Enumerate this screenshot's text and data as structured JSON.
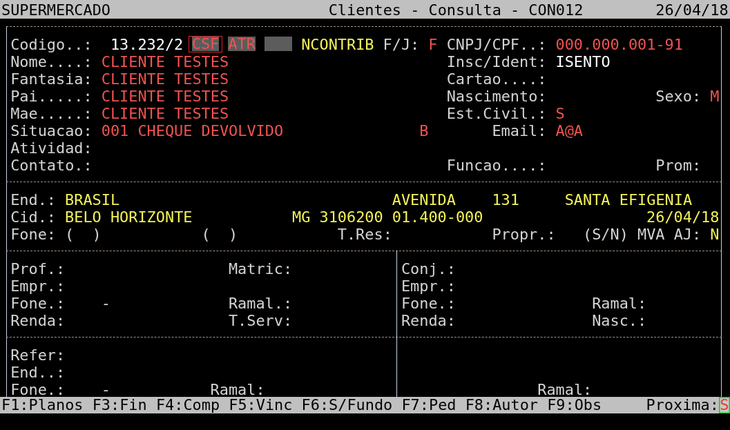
{
  "title_bar": {
    "system": "SUPERMERCADO",
    "title": "Clientes - Consulta - CON012",
    "date": "26/04/18"
  },
  "client": {
    "fields": [
      {
        "label": "Codigo..:",
        "value": "13.232/2",
        "color": "#ffffff",
        "flags": [
          {
            "kind": "tag",
            "text": "CSF",
            "selected": true
          },
          {
            "kind": "tag",
            "text": "ATR",
            "selected": false
          },
          {
            "kind": "blank",
            "selected": false
          }
        ]
      },
      {
        "value": "NCONTRIB",
        "color": "#f2f25a"
      },
      {
        "label": "F/J:",
        "value": "F",
        "color": "#ef5350"
      },
      {
        "label": "CNPJ/CPF..:",
        "value": "000.000.001-91",
        "color": "#ef5350"
      },
      {
        "label": "Nome....:",
        "value": "CLIENTE TESTES",
        "color": "#ef5350"
      },
      {
        "label": "Insc/Ident:",
        "value": "ISENTO",
        "color": "#ffffff"
      },
      {
        "label": "Fantasia:",
        "value": "CLIENTE TESTES",
        "color": "#ef5350"
      },
      {
        "label": "Cartao....:"
      },
      {
        "label": "Pai.....:",
        "value": "CLIENTE TESTES",
        "color": "#ef5350"
      },
      {
        "label": "Nascimento:"
      },
      {
        "label": "Sexo:",
        "value": "M",
        "color": "#ef5350"
      },
      {
        "label": "Mae.....:",
        "value": "CLIENTE TESTES",
        "color": "#ef5350"
      },
      {
        "label": "Est.Civil.:",
        "value": "S",
        "color": "#ef5350"
      },
      {
        "label": "Situacao:",
        "value": "001 CHEQUE DEVOLVIDO",
        "color": "#ef5350"
      },
      {
        "value": "B",
        "color": "#ef5350"
      },
      {
        "label": "Email:",
        "value": "A@A",
        "color": "#ef5350"
      },
      {
        "label": "Atividad:"
      },
      {
        "label": "Contato.:"
      },
      {
        "label": "Funcao....:"
      },
      {
        "label": "Prom:"
      }
    ]
  },
  "address": {
    "fields": [
      {
        "label": "End.:",
        "value": "BRASIL",
        "color": "#f2f25a"
      },
      {
        "value": "AVENIDA",
        "color": "#f2f25a"
      },
      {
        "value": "131",
        "color": "#f2f25a"
      },
      {
        "value": "SANTA EFIGENIA",
        "color": "#f2f25a"
      },
      {
        "label": "Cid.:",
        "value": "BELO HORIZONTE",
        "color": "#f2f25a"
      },
      {
        "value": "MG",
        "color": "#f2f25a"
      },
      {
        "value": "3106200",
        "color": "#f2f25a"
      },
      {
        "value": "01.400-000",
        "color": "#f2f25a"
      },
      {
        "value": "26/04/18",
        "color": "#f2f25a"
      },
      {
        "label": "Fone:",
        "value": "(  )",
        "color": "#d3d3d3"
      },
      {
        "value": "(  )",
        "color": "#d3d3d3"
      },
      {
        "label": "T.Res:"
      },
      {
        "label": "Propr.:"
      },
      {
        "label": "(S/N) MVA AJ:",
        "value": "N",
        "color": "#f2f25a"
      }
    ]
  },
  "employment": {
    "fields": [
      {
        "label": "Prof.:"
      },
      {
        "label": "Matric:"
      },
      {
        "label": "Empr.:"
      },
      {
        "label": "Fone.:",
        "value": "-",
        "color": "#d3d3d3"
      },
      {
        "label": "Ramal.:"
      },
      {
        "label": "Renda:"
      },
      {
        "label": "T.Serv:"
      }
    ]
  },
  "spouse": {
    "fields": [
      {
        "label": "Conj.:"
      },
      {
        "label": "Empr.:"
      },
      {
        "label": "Fone.:"
      },
      {
        "label": "Ramal:"
      },
      {
        "label": "Renda:"
      },
      {
        "label": "Nasc.:"
      }
    ]
  },
  "reference": {
    "fields": [
      {
        "label": "Refer:"
      },
      {
        "label": "End..:"
      },
      {
        "label": "Fone.:",
        "value": "-",
        "color": "#d3d3d3"
      },
      {
        "label": "Ramal:"
      }
    ]
  },
  "reference_right": {
    "fields": [
      {
        "label": "Ramal:"
      }
    ]
  },
  "function_bar": {
    "keys": [
      "F1:Planos",
      "F3:Fin",
      "F4:Comp",
      "F5:Vinc",
      "F6:S/Fundo",
      "F7:Ped",
      "F8:Autor",
      "F9:Obs"
    ],
    "prompt": {
      "label": "Proxima:",
      "value": "S",
      "cursor": true
    }
  }
}
